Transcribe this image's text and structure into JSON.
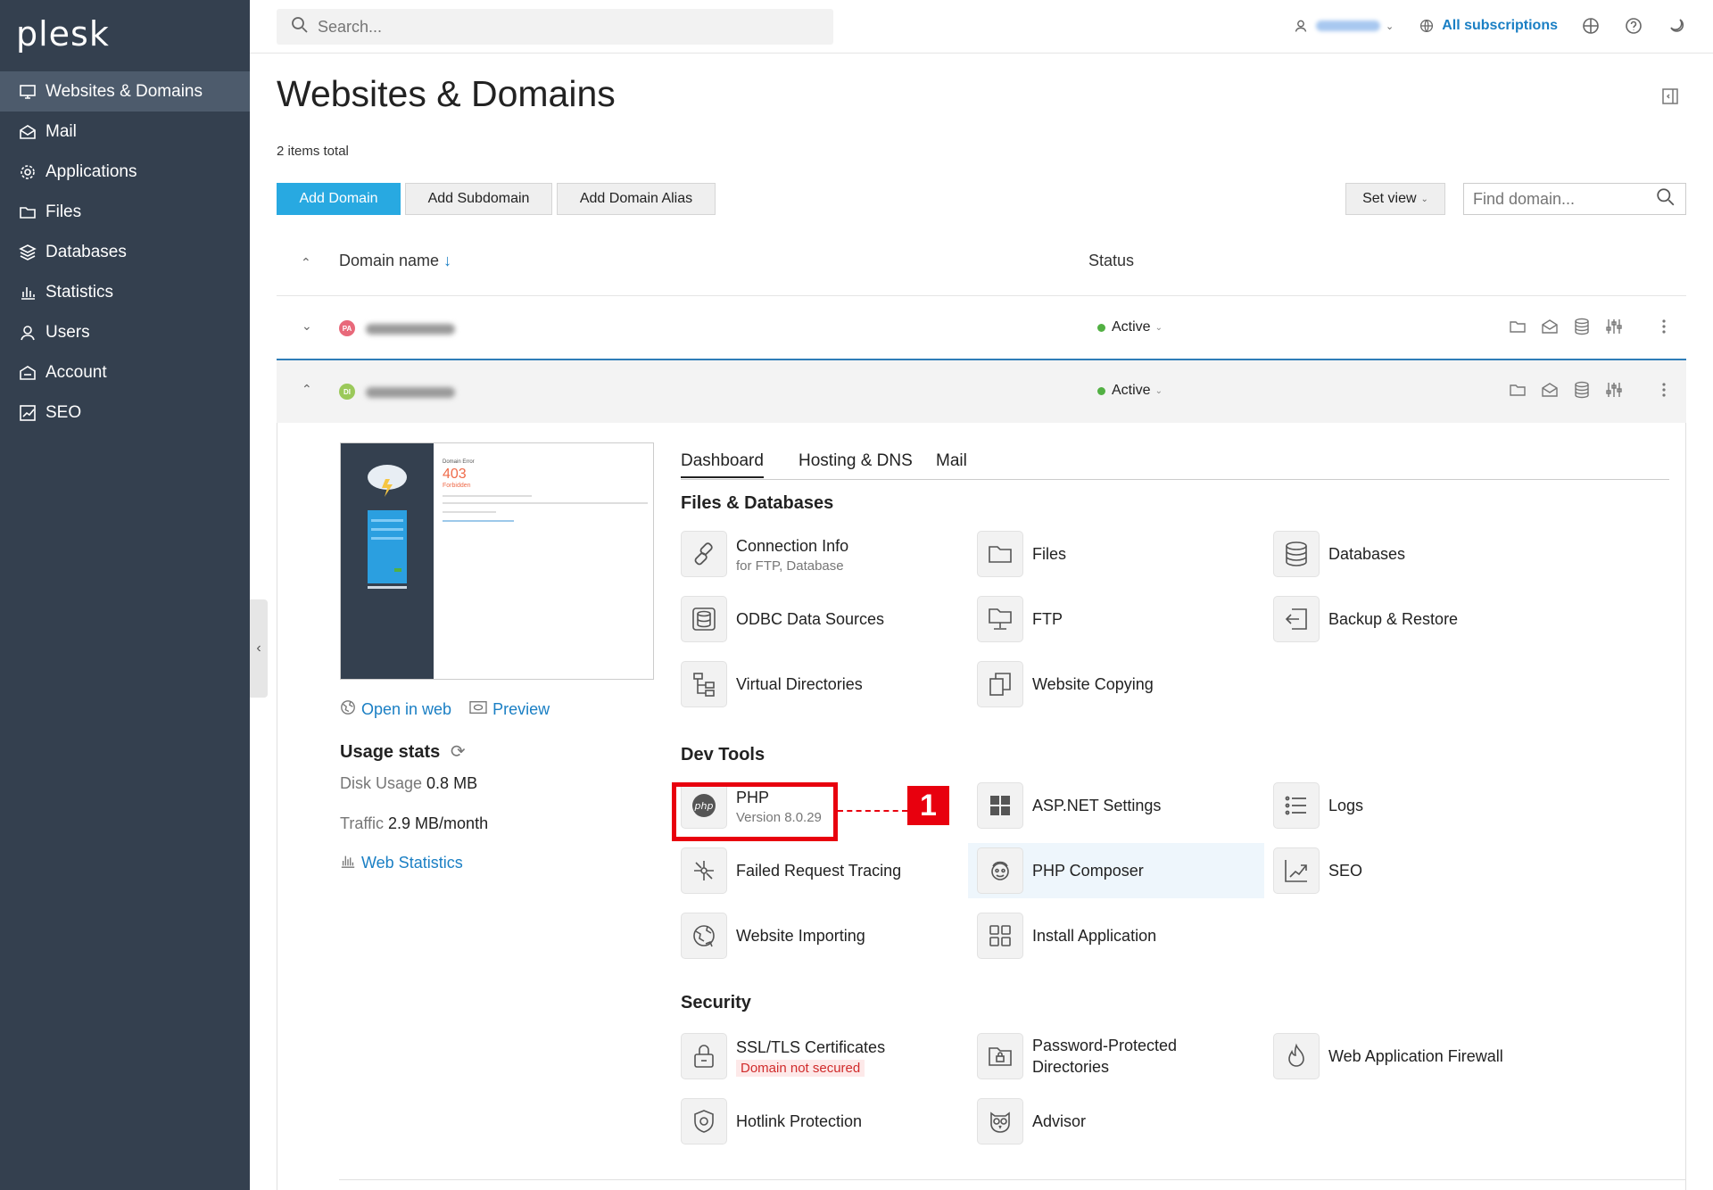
{
  "app": {
    "logo": "plesk"
  },
  "sidebar": {
    "items": [
      {
        "label": "Websites & Domains",
        "icon": "monitor-icon",
        "active": true
      },
      {
        "label": "Mail",
        "icon": "mail-icon"
      },
      {
        "label": "Applications",
        "icon": "gear-icon"
      },
      {
        "label": "Files",
        "icon": "folder-icon"
      },
      {
        "label": "Databases",
        "icon": "database-icon"
      },
      {
        "label": "Statistics",
        "icon": "bar-chart-icon"
      },
      {
        "label": "Users",
        "icon": "user-icon"
      },
      {
        "label": "Account",
        "icon": "account-icon"
      },
      {
        "label": "SEO",
        "icon": "seo-icon"
      }
    ]
  },
  "topbar": {
    "search_placeholder": "Search...",
    "subscriptions": "All subscriptions"
  },
  "page": {
    "title": "Websites & Domains",
    "items_total": "2 items total",
    "buttons": {
      "add_domain": "Add Domain",
      "add_subdomain": "Add Subdomain",
      "add_alias": "Add Domain Alias",
      "set_view": "Set view"
    },
    "find_placeholder": "Find domain...",
    "columns": {
      "domain": "Domain name",
      "status": "Status"
    },
    "rows": [
      {
        "favicon": "PA",
        "favicon_color": "#e8697a",
        "status": "Active"
      },
      {
        "favicon": "DI",
        "favicon_color": "#9bc95a",
        "status": "Active"
      }
    ]
  },
  "preview": {
    "thumb_title": "Domain Error",
    "thumb_code": "403",
    "thumb_sub": "Forbidden",
    "open_in_web": "Open in web",
    "preview": "Preview",
    "usage_title": "Usage stats",
    "disk_label": "Disk Usage",
    "disk_value": "0.8 MB",
    "traffic_label": "Traffic",
    "traffic_value": "2.9 MB/month",
    "web_stats": "Web Statistics"
  },
  "tabs": [
    "Dashboard",
    "Hosting & DNS",
    "Mail"
  ],
  "sections": {
    "files": "Files & Databases",
    "dev": "Dev Tools",
    "security": "Security"
  },
  "tools": {
    "connection_info": {
      "label": "Connection Info",
      "sub": "for FTP, Database"
    },
    "files": {
      "label": "Files"
    },
    "databases": {
      "label": "Databases"
    },
    "odbc": {
      "label": "ODBC Data Sources"
    },
    "ftp": {
      "label": "FTP"
    },
    "backup": {
      "label": "Backup & Restore"
    },
    "vdirs": {
      "label": "Virtual Directories"
    },
    "copying": {
      "label": "Website Copying"
    },
    "php": {
      "label": "PHP",
      "sub": "Version 8.0.29"
    },
    "aspnet": {
      "label": "ASP.NET Settings"
    },
    "logs": {
      "label": "Logs"
    },
    "frt": {
      "label": "Failed Request Tracing"
    },
    "composer": {
      "label": "PHP Composer"
    },
    "seo": {
      "label": "SEO"
    },
    "importing": {
      "label": "Website Importing"
    },
    "install_app": {
      "label": "Install Application"
    },
    "ssl": {
      "label": "SSL/TLS Certificates",
      "sub": "Domain not secured"
    },
    "protected_dirs": {
      "label": "Password-Protected",
      "label2": "Directories"
    },
    "waf": {
      "label": "Web Application Firewall"
    },
    "hotlink": {
      "label": "Hotlink Protection"
    },
    "advisor": {
      "label": "Advisor"
    }
  },
  "annotation": {
    "badge": "1"
  },
  "colors": {
    "sidebar": "#34404f",
    "primary": "#28a9e1",
    "link": "#1a7fc4",
    "highlight": "#e8000e",
    "status_active": "#52b043"
  }
}
